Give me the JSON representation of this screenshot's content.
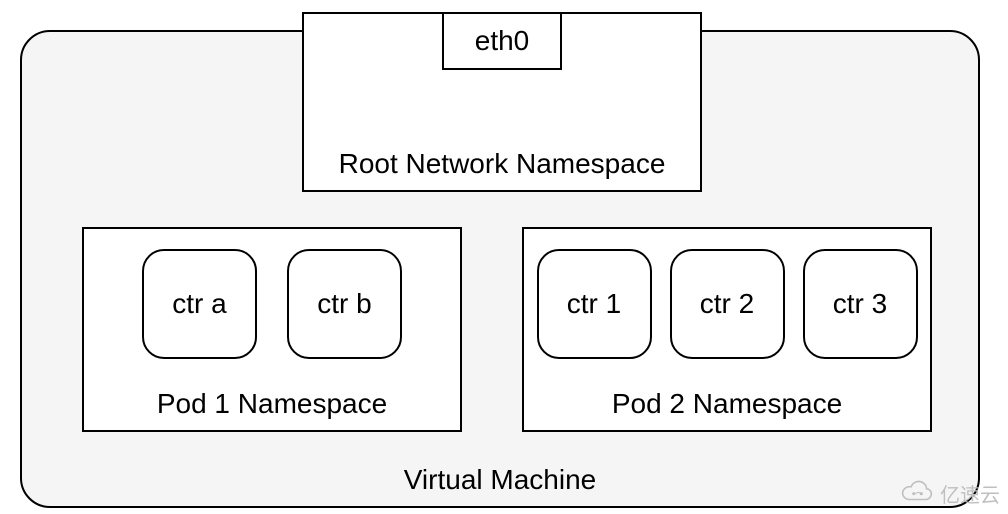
{
  "vm": {
    "label": "Virtual Machine"
  },
  "root_ns": {
    "label": "Root Network Namespace",
    "eth": "eth0"
  },
  "pod1": {
    "label": "Pod 1 Namespace",
    "containers": [
      "ctr a",
      "ctr b"
    ]
  },
  "pod2": {
    "label": "Pod 2 Namespace",
    "containers": [
      "ctr 1",
      "ctr 2",
      "ctr 3"
    ]
  },
  "watermark": {
    "text": "亿速云"
  }
}
